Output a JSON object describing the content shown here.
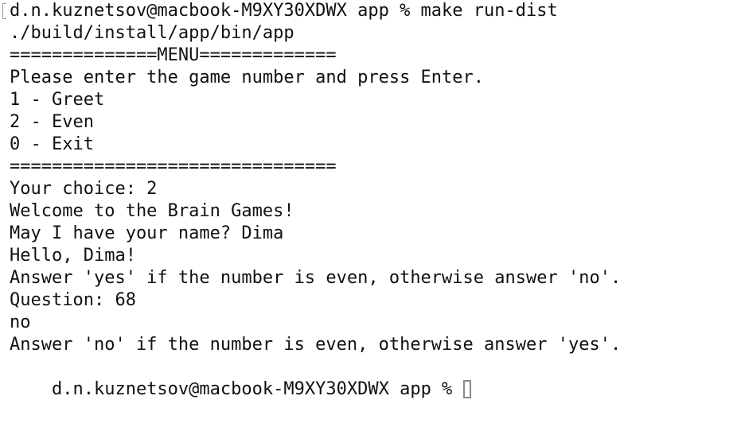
{
  "terminal": {
    "lines": [
      "d.n.kuznetsov@macbook-M9XY30XDWX app % make run-dist",
      "./build/install/app/bin/app",
      "==============MENU=============",
      "Please enter the game number and press Enter.",
      "1 - Greet",
      "2 - Even",
      "0 - Exit",
      "===============================",
      "Your choice: 2",
      "Welcome to the Brain Games!",
      "May I have your name? Dima",
      "Hello, Dima!",
      "Answer 'yes' if the number is even, otherwise answer 'no'.",
      "Question: 68",
      "no",
      "Answer 'no' if the number is even, otherwise answer 'yes'.",
      "d.n.kuznetsov@macbook-M9XY30XDWX app % "
    ]
  }
}
